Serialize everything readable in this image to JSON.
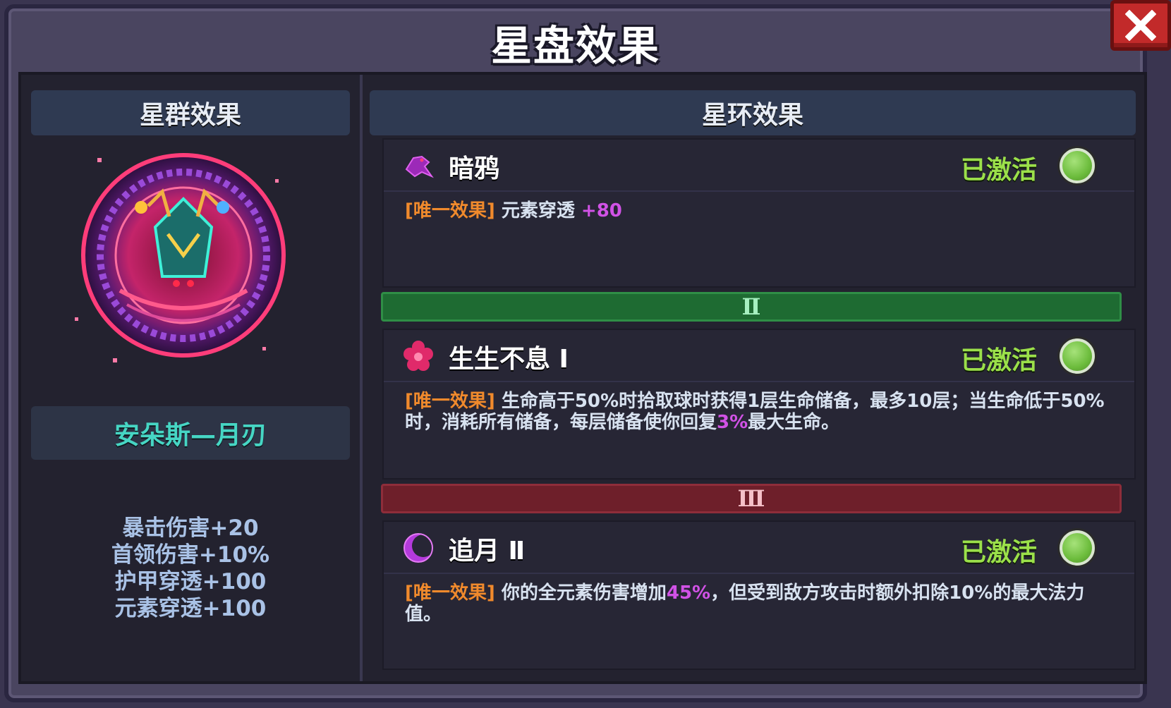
{
  "window": {
    "title": "星盘效果",
    "close_icon": "close-icon"
  },
  "left_panel": {
    "header": "星群效果",
    "constellation_name": "安朵斯—月刃",
    "stats": [
      "暴击伤害+20",
      "首领伤害+10%",
      "护甲穿透+100",
      "元素穿透+100"
    ]
  },
  "right_panel": {
    "header": "星环效果",
    "effects": [
      {
        "icon": "raven-icon",
        "name": "暗鸦",
        "status": "已激活",
        "tag": "[唯一效果]",
        "desc_parts": [
          "元素穿透 ",
          "+80",
          ""
        ]
      },
      {
        "icon": "flower-icon",
        "name": "生生不息 Ⅰ",
        "status": "已激活",
        "tag": "[唯一效果]",
        "desc_parts": [
          "生命高于50%时拾取球时获得1层生命储备，最多10层；当生命低于50%时，消耗所有储备，每层储备使你回复",
          "3%",
          "最大生命。"
        ]
      },
      {
        "icon": "crescent-moon-icon",
        "name": "追月 Ⅱ",
        "status": "已激活",
        "tag": "[唯一效果]",
        "desc_parts": [
          "你的全元素伤害增加",
          "45%",
          "，但受到敌方攻击时额外扣除10%的最大法力值。"
        ]
      }
    ],
    "tiers": [
      "Ⅱ",
      "Ⅲ"
    ]
  },
  "colors": {
    "active_green": "#9be04a",
    "tag_orange": "#f08a2c",
    "highlight_purple": "#d152e6",
    "name_teal": "#46d6c4",
    "tier2_green": "#1e6b32",
    "tier3_red": "#6e1f2a"
  }
}
